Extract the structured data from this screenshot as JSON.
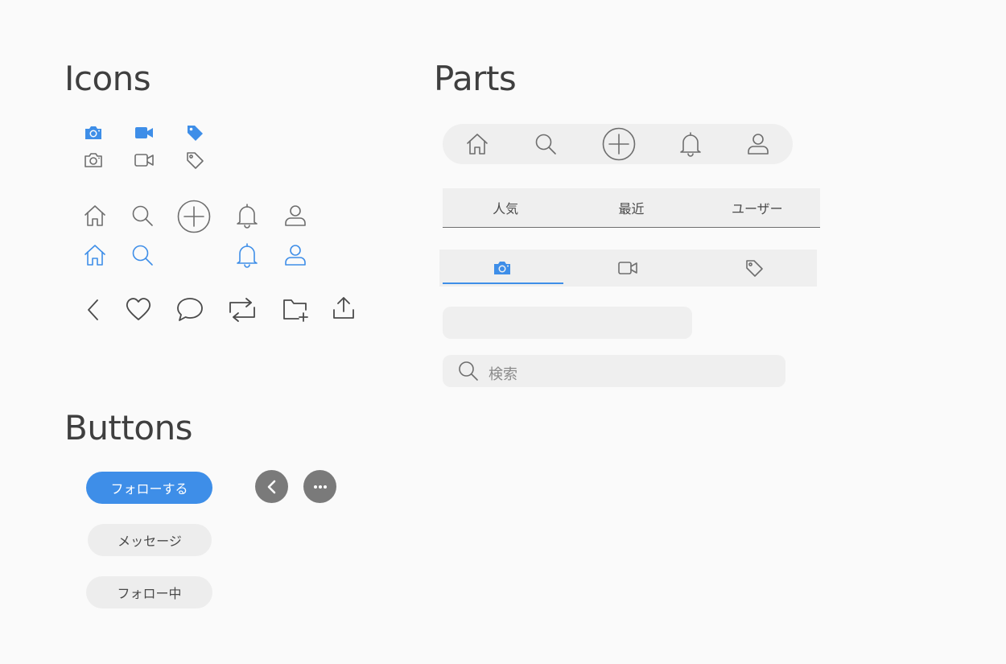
{
  "sections": {
    "icons_title": "Icons",
    "parts_title": "Parts",
    "buttons_title": "Buttons"
  },
  "colors": {
    "accent": "#3e8ee8",
    "icon_gray": "#6e6e6e",
    "background": "#fafafa",
    "surface": "#efefef"
  },
  "icons": {
    "media_row": [
      "camera-icon",
      "video-icon",
      "tag-icon"
    ],
    "nav_row": [
      "home-icon",
      "search-icon",
      "add-circle-icon",
      "bell-icon",
      "user-icon"
    ],
    "action_row": [
      "chevron-left-icon",
      "heart-icon",
      "comment-icon",
      "repost-icon",
      "folder-add-icon",
      "share-icon"
    ]
  },
  "parts": {
    "text_tabs": [
      "人気",
      "最近",
      "ユーザー"
    ],
    "icon_tabs": [
      "camera-icon",
      "video-icon",
      "tag-icon"
    ],
    "search": {
      "placeholder": "検索"
    }
  },
  "buttons": {
    "follow": "フォローする",
    "message": "メッセージ",
    "following": "フォロー中"
  }
}
